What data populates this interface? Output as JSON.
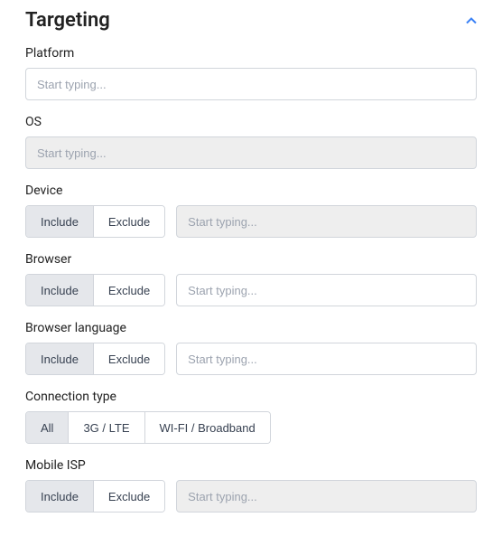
{
  "section": {
    "title": "Targeting"
  },
  "fields": {
    "platform": {
      "label": "Platform",
      "placeholder": "Start typing..."
    },
    "os": {
      "label": "OS",
      "placeholder": "Start typing..."
    },
    "device": {
      "label": "Device",
      "include": "Include",
      "exclude": "Exclude",
      "placeholder": "Start typing..."
    },
    "browser": {
      "label": "Browser",
      "include": "Include",
      "exclude": "Exclude",
      "placeholder": "Start typing..."
    },
    "browserLanguage": {
      "label": "Browser language",
      "include": "Include",
      "exclude": "Exclude",
      "placeholder": "Start typing..."
    },
    "connectionType": {
      "label": "Connection type",
      "all": "All",
      "threeg": "3G / LTE",
      "wifi": "WI-FI / Broadband"
    },
    "mobileIsp": {
      "label": "Mobile ISP",
      "include": "Include",
      "exclude": "Exclude",
      "placeholder": "Start typing..."
    }
  }
}
